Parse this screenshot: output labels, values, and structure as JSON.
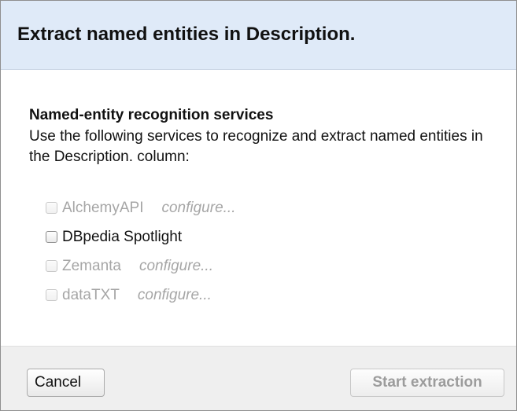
{
  "dialog": {
    "title": "Extract named entities in Description."
  },
  "section": {
    "heading": "Named-entity recognition services",
    "description": "Use the following services to recognize and extract named entities in the Description. column:"
  },
  "services": [
    {
      "name": "AlchemyAPI",
      "checked": false,
      "enabled": false,
      "configure_label": "configure..."
    },
    {
      "name": "DBpedia Spotlight",
      "checked": false,
      "enabled": true,
      "configure_label": ""
    },
    {
      "name": "Zemanta",
      "checked": false,
      "enabled": false,
      "configure_label": "configure..."
    },
    {
      "name": "dataTXT",
      "checked": false,
      "enabled": false,
      "configure_label": "configure..."
    }
  ],
  "footer": {
    "cancel_label": "Cancel",
    "start_label": "Start extraction",
    "start_enabled": false
  },
  "icons": {
    "checkbox": "checkbox-unchecked-icon"
  },
  "colors": {
    "header_background": "#dfeaf8",
    "footer_background": "#efefef",
    "disabled_text": "#a6a6a6",
    "text": "#111111"
  }
}
